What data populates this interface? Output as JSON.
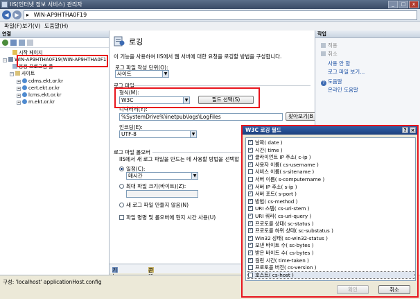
{
  "window": {
    "title": "IIS(인터넷 정보 서비스) 관리자"
  },
  "address": {
    "path": "WIN-AP9HTHA0F19",
    "separator": "▸"
  },
  "menu": {
    "file": "파일(F)",
    "view": "보기(V)",
    "help": "도움말(H)"
  },
  "connections": {
    "header": "연결",
    "start_page": "시작 페이지",
    "server": "WIN-AP9HTHA0F19(WIN-AP9HTHA0F1",
    "app_pools": "응용 프로그램 풀",
    "sites": "사이트",
    "site_list": [
      "cdms.ekt.or.kr",
      "cert.ekt.or.kr",
      "lcms.ekt.or.kr",
      "m.ekt.or.kr"
    ]
  },
  "logging": {
    "title": "로깅",
    "description": "이 기능을 사용하여 IIS에서 웹 서버에 대한 요청을 로깅할 방법을 구성합니다.",
    "per_label": "로그 파일 작성 단위(O):",
    "per_value": "사이트",
    "logfile_group": "로그 파일",
    "format_label": "형식(M):",
    "format_value": "W3C",
    "select_fields_button": "필드 선택(S)",
    "directory_label": "디렉터리(Y):",
    "directory_value": "%SystemDrive%\\inetpub\\logs\\LogFiles",
    "browse_button": "찾아보기(B",
    "encoding_label": "인코딩(E):",
    "encoding_value": "UTF-8",
    "rollover_group": "로그 파일 롤오버",
    "rollover_desc": "IIS에서 새 로그 파일을 만드는 데 사용할 방법을 선택합",
    "schedule_label": "일정(C):",
    "schedule_value": "매시간",
    "max_size_label": "최대 파일 크기(바이트)(Z):",
    "no_new_label": "새 로그 파일 만들지 않음(N)",
    "local_time_label": "파일 명명 및 롤오버에 현지 시간 사용(U)"
  },
  "view_tabs": {
    "features": "기능 보기",
    "content": "콘텐츠 보기"
  },
  "actions": {
    "header": "작업",
    "apply": "적용",
    "cancel": "취소",
    "disable": "사용 안 함",
    "view_logs": "로그 파일 보기...",
    "help": "도움말",
    "online_help": "온라인 도움말"
  },
  "status": {
    "text": "구성: 'localhost' applicationHost.config"
  },
  "dialog": {
    "title": "W3C 로깅 필드",
    "help_glyph": "?",
    "close_glyph": "×",
    "fields": [
      {
        "label": "날짜( date )",
        "checked": true
      },
      {
        "label": "시간( time )",
        "checked": true
      },
      {
        "label": "클라이언트 IP 주소( c-ip )",
        "checked": true
      },
      {
        "label": "사용자 이름( cs-username )",
        "checked": true
      },
      {
        "label": "서비스 이름( s-sitename )",
        "checked": false
      },
      {
        "label": "서버 이름( s-computername )",
        "checked": false
      },
      {
        "label": "서버 IP 주소( s-ip )",
        "checked": true
      },
      {
        "label": "서버 포트( s-port )",
        "checked": true
      },
      {
        "label": "방법( cs-method )",
        "checked": true
      },
      {
        "label": "URI 스템( cs-uri-stem )",
        "checked": true
      },
      {
        "label": "URI 쿼리( cs-uri-query )",
        "checked": true
      },
      {
        "label": "프로토콜 상태( sc-status )",
        "checked": true
      },
      {
        "label": "프로토콜 하위 상태( sc-substatus )",
        "checked": true
      },
      {
        "label": "Win32 상태( sc-win32-status )",
        "checked": true
      },
      {
        "label": "보낸 바이트 수( sc-bytes )",
        "checked": true
      },
      {
        "label": "받은 바이트 수( cs-bytes )",
        "checked": true
      },
      {
        "label": "걸린 시간( time-taken )",
        "checked": true
      },
      {
        "label": "프로토콜 버전( cs-version )",
        "checked": false
      },
      {
        "label": "호스트( cs-host )",
        "checked": false
      }
    ],
    "ok_button": "확인",
    "cancel_button": "취소"
  },
  "colors": {
    "highlight": "#e8141c",
    "title_blue": "#1c3f7c",
    "panel_border": "#a7b3c2"
  }
}
